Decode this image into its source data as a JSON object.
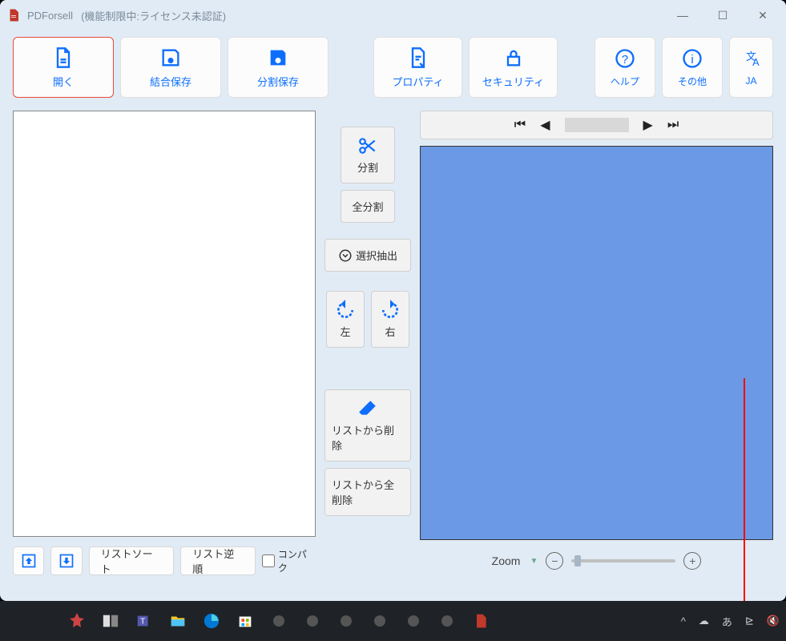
{
  "window": {
    "app_name": "PDForsell",
    "subtitle": "(機能制限中:ライセンス未認証)"
  },
  "toolbar": {
    "open": "開く",
    "merge_save": "結合保存",
    "split_save": "分割保存",
    "property": "プロパティ",
    "security": "セキュリティ",
    "help": "ヘルプ",
    "other": "その他",
    "lang": "JA"
  },
  "mid": {
    "split": "分割",
    "split_all": "全分割",
    "select_extract": "選択抽出",
    "rotate_left": "左",
    "rotate_right": "右",
    "remove_from_list": "リストから削除",
    "remove_all_from_list": "リストから全削除"
  },
  "left_footer": {
    "sort": "リストソート",
    "reverse": "リスト逆順",
    "compact": "コンパク"
  },
  "right": {
    "zoom_label": "Zoom"
  },
  "taskbar": {
    "ime": "あ"
  }
}
